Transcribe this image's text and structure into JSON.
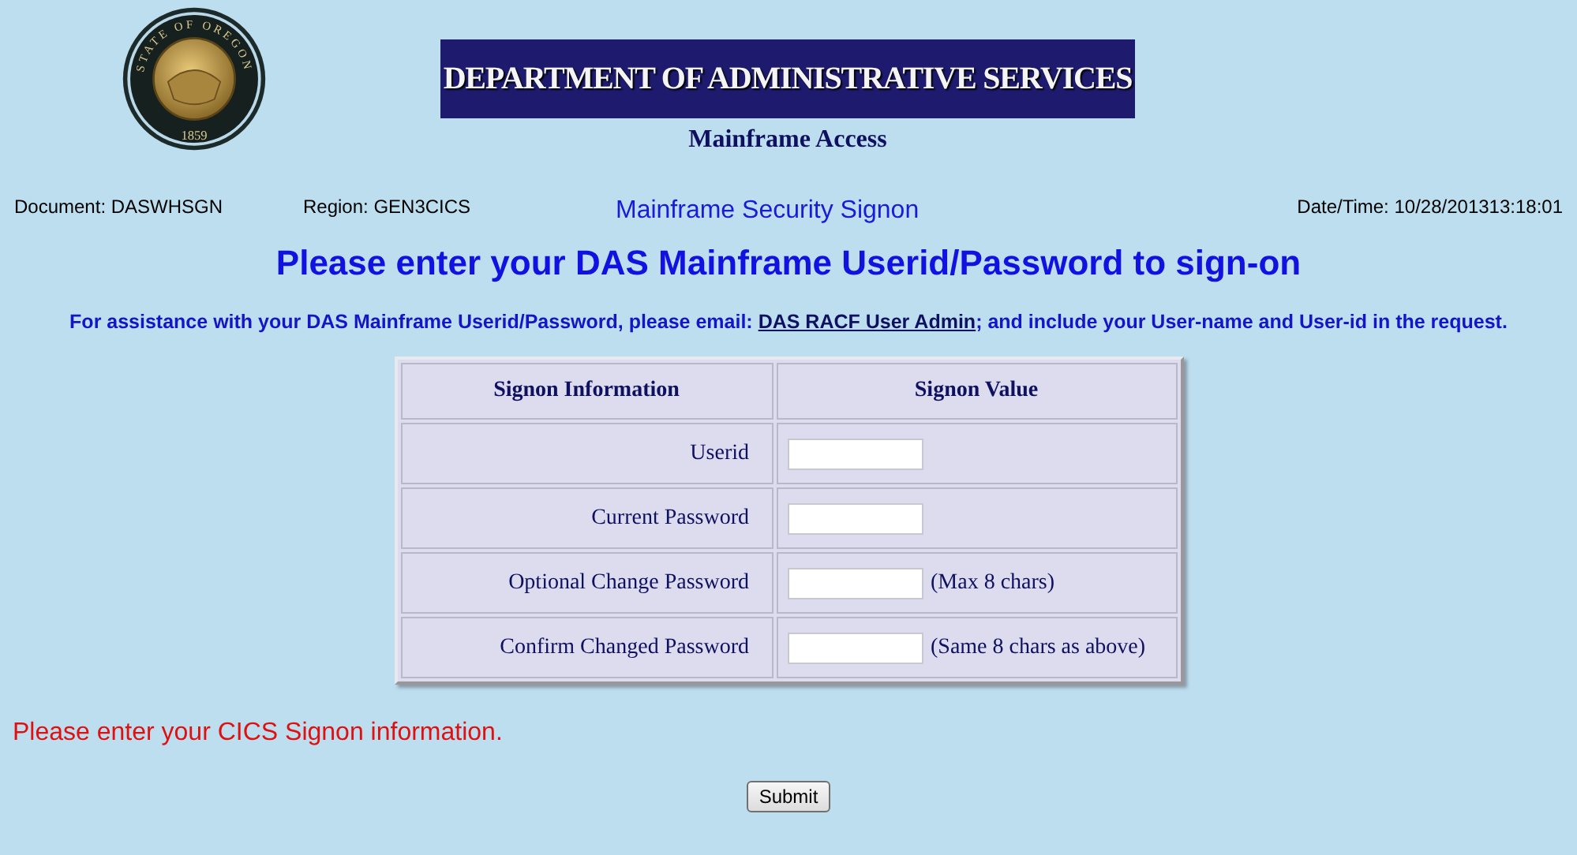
{
  "seal": {
    "ring_text": "STATE OF OREGON",
    "year": "1859"
  },
  "banner": "DEPARTMENT OF ADMINISTRATIVE SERVICES",
  "subtitle": "Mainframe Access",
  "info": {
    "document": "Document: DASWHSGN",
    "region": "Region: GEN3CICS",
    "title": "Mainframe Security Signon",
    "datetime": "Date/Time: 10/28/201313:18:01"
  },
  "heading": "Please enter your DAS Mainframe Userid/Password to sign-on",
  "assistance": {
    "before": "For assistance with your DAS Mainframe Userid/Password, please email:",
    "link": "DAS RACF User Admin",
    "after": "; and include your User-name and User-id in the request."
  },
  "table": {
    "columns": [
      "Signon Information",
      "Signon Value"
    ],
    "rows": [
      {
        "label": "Userid"
      },
      {
        "label": "Current Password"
      },
      {
        "label": "Optional Change Password",
        "note": "(Max 8 chars)"
      },
      {
        "label": "Confirm Changed Password",
        "note": "(Same 8 chars as above)"
      }
    ]
  },
  "message": "Please enter your CICS Signon information.",
  "submit": "Submit"
}
